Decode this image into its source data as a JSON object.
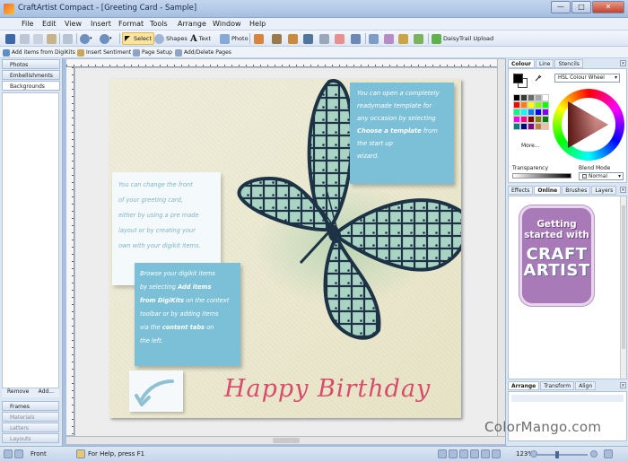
{
  "window": {
    "title": "CraftArtist Compact - [Greeting Card - Sample]",
    "controls": [
      "—",
      "□",
      "✕"
    ]
  },
  "menu": [
    "File",
    "Edit",
    "View",
    "Insert",
    "Format",
    "Tools",
    "Arrange",
    "Window",
    "Help"
  ],
  "toolbar": {
    "select_label": "Select",
    "shapes_label": "Shapes",
    "text_label": "Text",
    "photo_label": "Photo",
    "daisytrail_label": "DaisyTrail Upload"
  },
  "context_toolbar": {
    "add_items": "Add items from DigiKits",
    "insert_sentiment": "Insert Sentiment",
    "page_setup": "Page Setup",
    "add_delete_pages": "Add/Delete Pages"
  },
  "left_panel": {
    "tabs": [
      "Photos",
      "Embellishments",
      "Backgrounds"
    ],
    "remove_label": "Remove",
    "add_label": "Add...",
    "bottom_tabs": [
      "Frames",
      "Materials",
      "Letters",
      "Layouts"
    ]
  },
  "card": {
    "note1": [
      "You can open a completely",
      "readymade template for",
      "any occasion by selecting",
      "Choose a template",
      " from",
      "the start up",
      "wizard."
    ],
    "note2": [
      "You can change the front",
      "of your greeting card,",
      "either by using a pre made",
      "layout or by creating your",
      "own with your digikit items."
    ],
    "note3": [
      "Browse your digikit items",
      "by selecting",
      "Add items",
      "from DigiKits",
      "on the context",
      "toolbar or by adding items",
      "via the",
      "content tabs",
      "on",
      "the left."
    ],
    "greeting": "Happy Birthday"
  },
  "right_panel": {
    "colour_tabs": [
      "Colour",
      "Line",
      "Stencils"
    ],
    "colour_mode": "HSL Colour Wheel",
    "more_label": "More...",
    "transparency_label": "Transparency",
    "blend_mode_label": "Blend Mode",
    "blend_mode_value": "Normal",
    "panel_tabs": [
      "Effects",
      "Online",
      "Brushes",
      "Layers"
    ],
    "promo_line1": "Getting",
    "promo_line2": "started with",
    "promo_brand1": "CRAFT",
    "promo_brand2": "ARTIST",
    "arrange_tabs": [
      "Arrange",
      "Transform",
      "Align"
    ],
    "palette": [
      "#000000",
      "#3a3a3a",
      "#6b6b6b",
      "#a6a6a6",
      "#ffffff",
      "#ff0000",
      "#ff8000",
      "#ffff00",
      "#80ff00",
      "#00ff00",
      "#00ff80",
      "#00ffff",
      "#0080ff",
      "#0000ff",
      "#8000ff",
      "#ff00ff",
      "#ff0080",
      "#800000",
      "#808000",
      "#008000",
      "#008080",
      "#000080",
      "#800080",
      "#c08040",
      "#f0c0a0"
    ]
  },
  "status": {
    "page_label": "Front",
    "help_text": "For Help, press F1",
    "zoom": "123%"
  },
  "watermark": "ColorMango.com"
}
